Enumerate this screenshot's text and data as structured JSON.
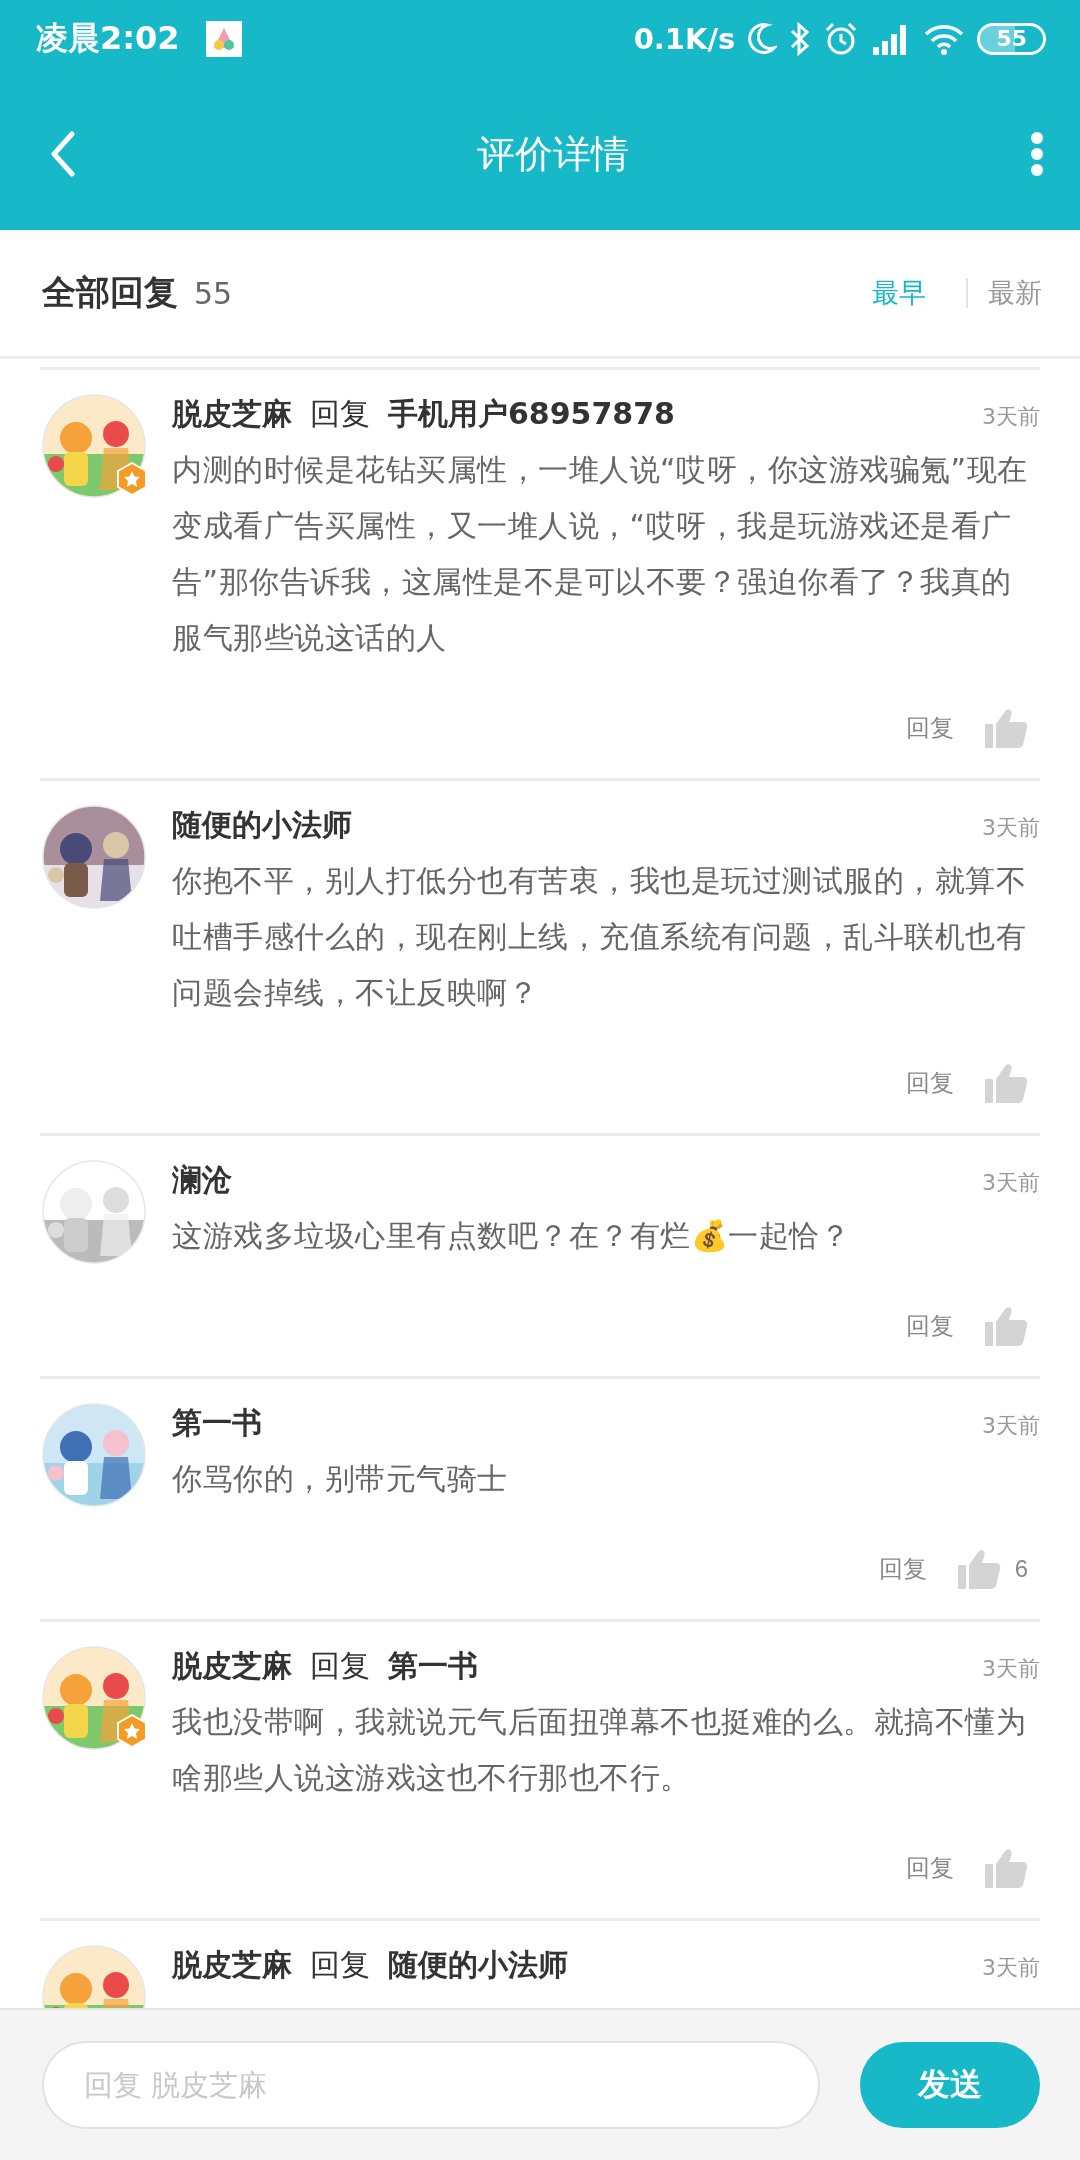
{
  "status_bar": {
    "time": "凌晨2:02",
    "net_speed": "0.1K/s",
    "battery": "55"
  },
  "header": {
    "title": "评价详情"
  },
  "replies_header": {
    "title": "全部回复",
    "count": "55",
    "sorts": [
      {
        "label": "最早",
        "selected": true
      },
      {
        "label": "最新",
        "selected": false
      }
    ]
  },
  "comments": [
    {
      "author": "脱皮芝麻",
      "reply_label": "回复",
      "reply_to": "手机用户68957878",
      "badge": true,
      "time": "3天前",
      "body": "内测的时候是花钻买属性，一堆人说“哎呀，你这游戏骗氪”现在变成看广告买属性，又一堆人说，“哎呀，我是玩游戏还是看广告”那你告诉我，这属性是不是可以不要？强迫你看了？我真的服气那些说这话的人",
      "reply_button": "回复"
    },
    {
      "author": "随便的小法师",
      "badge": false,
      "time": "3天前",
      "body": "你抱不平，别人打低分也有苦衷，我也是玩过测试服的，就算不吐槽手感什么的，现在刚上线，充值系统有问题，乱斗联机也有问题会掉线，不让反映啊？",
      "reply_button": "回复"
    },
    {
      "author": "澜沧",
      "badge": false,
      "time": "3天前",
      "body": "这游戏多垃圾心里有点数吧？在？有烂💰一起恰？",
      "reply_button": "回复"
    },
    {
      "author": "第一书",
      "badge": false,
      "time": "3天前",
      "body": "你骂你的，别带元气骑士",
      "reply_button": "回复",
      "likes": "6"
    },
    {
      "author": "脱皮芝麻",
      "reply_label": "回复",
      "reply_to": "第一书",
      "badge": true,
      "time": "3天前",
      "body": "我也没带啊，我就说元气后面扭弹幕不也挺难的么。就搞不懂为啥那些人说这游戏这也不行那也不行。",
      "reply_button": "回复"
    },
    {
      "author": "脱皮芝麻",
      "reply_label": "回复",
      "reply_to": "随便的小法师",
      "time": "3天前"
    }
  ],
  "composer": {
    "placeholder": "回复 脱皮芝麻",
    "send": "发送"
  }
}
